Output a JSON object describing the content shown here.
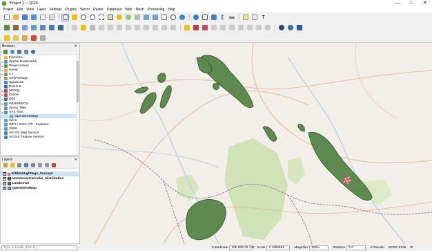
{
  "window": {
    "title": "*Project 1 — QGIS",
    "controls": [
      "—",
      "□",
      "✕"
    ]
  },
  "menu": [
    "Project",
    "Edit",
    "View",
    "Layer",
    "Settings",
    "Plugins",
    "Vector",
    "Raster",
    "Database",
    "Web",
    "Mesh",
    "Processing",
    "Help"
  ],
  "browser": {
    "title": "Browser",
    "items": [
      {
        "label": "Favorites",
        "expandable": false,
        "color": "#e8c21a"
      },
      {
        "label": "Spatial Bookmarks",
        "expandable": true,
        "color": "#5b8ec9"
      },
      {
        "label": "Project Home",
        "expandable": true,
        "color": "#4f9a3a"
      },
      {
        "label": "Home",
        "expandable": true,
        "color": "#e0b040"
      },
      {
        "label": "C:\\",
        "expandable": true,
        "color": "#888888"
      },
      {
        "label": "GeoPackage",
        "expandable": false,
        "color": "#8aa95a"
      },
      {
        "label": "SpatiaLite",
        "expandable": false,
        "color": "#4a7fc0"
      },
      {
        "label": "PostGIS",
        "expandable": false,
        "color": "#336699"
      },
      {
        "label": "MSSQL",
        "expandable": true,
        "color": "#c04040"
      },
      {
        "label": "Oracle",
        "expandable": true,
        "color": "#c05050"
      },
      {
        "label": "DB2",
        "expandable": true,
        "color": "#3a6ea5"
      },
      {
        "label": "WMS/WMTS",
        "expandable": true,
        "color": "#5a9ad0"
      },
      {
        "label": "Vector Tiles",
        "expandable": false,
        "color": "#6a8ab0"
      },
      {
        "label": "XYZ Tiles",
        "expandable": true,
        "color": "#4a8ad0"
      },
      {
        "label": "OpenStreetMap",
        "expandable": false,
        "color": "#7aa0c8",
        "child": true,
        "selected": true
      },
      {
        "label": "WCS",
        "expandable": false,
        "color": "#5a9ad0"
      },
      {
        "label": "WFS / OGC API - Features",
        "expandable": false,
        "color": "#5a9ad0"
      },
      {
        "label": "OWS",
        "expandable": false,
        "color": "#5a9ad0"
      },
      {
        "label": "ArcGIS Map Service",
        "expandable": false,
        "color": "#4a7fc0"
      },
      {
        "label": "ArcGIS Feature Service",
        "expandable": false,
        "color": "#4a7fc0"
      }
    ]
  },
  "layers": {
    "title": "Layers",
    "items": [
      {
        "label": "GibbonSightings_Survey1",
        "symbol": "point",
        "color": "#c0203a",
        "selected": true
      },
      {
        "label": "NomascusConcolor_Distribution",
        "symbol": "fill",
        "color": "#4e7a3f"
      },
      {
        "label": "LandCover",
        "symbol": "fill",
        "color": "#666666"
      },
      {
        "label": "OpenStreetMap",
        "symbol": "raster",
        "color": "#7aa0c8"
      }
    ]
  },
  "status": {
    "locate_placeholder": "Type to locate (Ctrl+K)",
    "coordinate_label": "Coordinate",
    "coordinate": "105.906,23.137",
    "scale_label": "Scale",
    "scale": "1:1993553",
    "magnifier_label": "Magnifier",
    "magnifier": "100%",
    "rotation_label": "Rotation",
    "rotation": "0.0 °",
    "render_label": "Render",
    "crs": "EPSG:4326"
  },
  "colors": {
    "habitat_fill": "#5e8a4f",
    "habitat_stroke": "#2f4f2a",
    "map_bg": "#f2efe9",
    "forest": "#cfe2b8",
    "border": "#8a5a8a",
    "road": "#e9b89a",
    "river": "#b5d0e8"
  }
}
